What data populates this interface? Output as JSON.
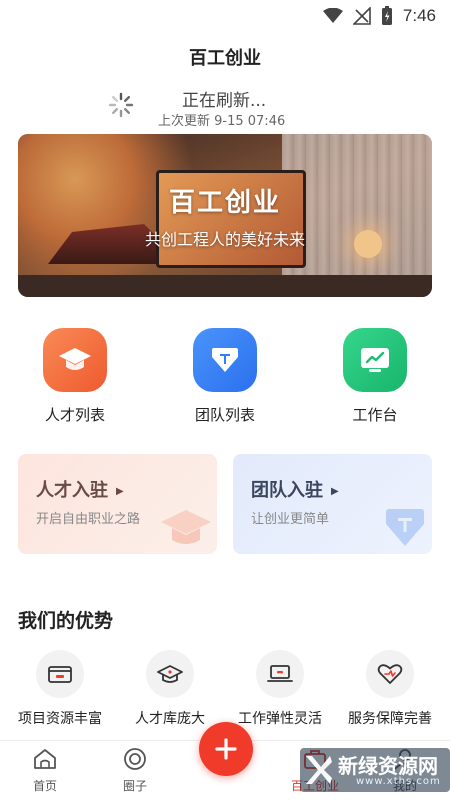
{
  "status_bar": {
    "time": "7:46"
  },
  "app": {
    "title": "百工创业"
  },
  "refresh": {
    "text": "正在刷新...",
    "last_update": "上次更新 9-15 07:46"
  },
  "banner": {
    "title": "百工创业",
    "subtitle": "共创工程人的美好未来"
  },
  "quick_actions": [
    {
      "label": "人才列表",
      "icon": "graduation-cap-icon",
      "color": "#f06a3f"
    },
    {
      "label": "团队列表",
      "icon": "team-shield-icon",
      "color": "#2f7ff5"
    },
    {
      "label": "工作台",
      "icon": "dashboard-chart-icon",
      "color": "#22c37a"
    }
  ],
  "entry_cards": [
    {
      "title": "人才入驻",
      "subtitle": "开启自由职业之路",
      "bg": "#fde9e4",
      "title_color": "#6a4a44"
    },
    {
      "title": "团队入驻",
      "subtitle": "让创业更简单",
      "bg": "#e6eefc",
      "title_color": "#3a4660"
    }
  ],
  "advantages": {
    "title": "我们的优势",
    "items": [
      {
        "label": "项目资源丰富",
        "icon": "wallet-icon"
      },
      {
        "label": "人才库庞大",
        "icon": "graduation-cap-icon"
      },
      {
        "label": "工作弹性灵活",
        "icon": "laptop-icon"
      },
      {
        "label": "服务保障完善",
        "icon": "heart-shield-icon"
      }
    ]
  },
  "tab_bar": {
    "tabs": [
      {
        "label": "首页",
        "icon": "home-icon"
      },
      {
        "label": "圈子",
        "icon": "circle-icon"
      },
      {
        "label": "百工创业",
        "icon": "briefcase-icon"
      },
      {
        "label": "我的",
        "icon": "user-icon"
      }
    ],
    "fab_icon": "plus-icon"
  },
  "watermark": {
    "main": "新绿资源网",
    "sub": "www.xths.com"
  },
  "colors": {
    "accent": "#f03a2a",
    "brand_orange": "#f06a3f",
    "brand_blue": "#2f7ff5",
    "brand_green": "#22c37a"
  }
}
